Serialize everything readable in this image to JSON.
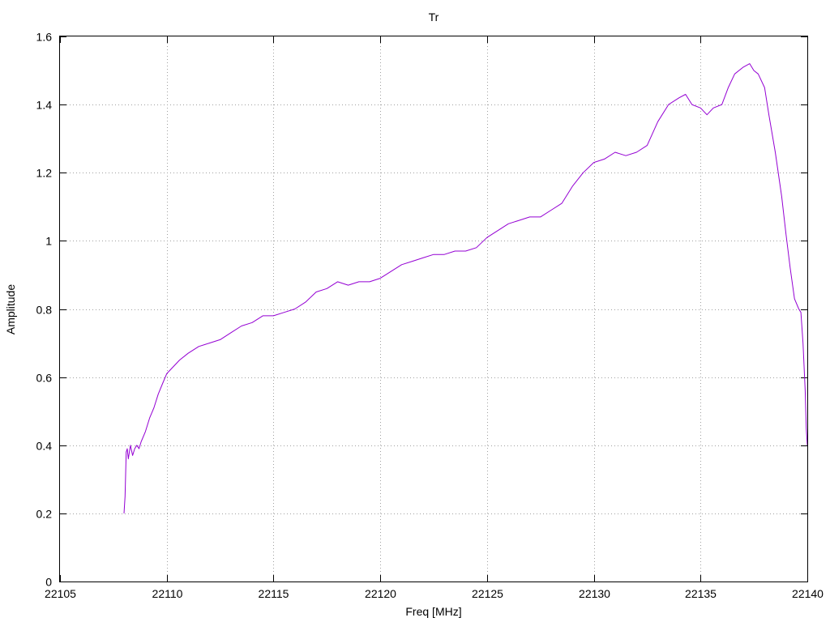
{
  "chart_data": {
    "type": "line",
    "title": "Tr",
    "xlabel": "Freq [MHz]",
    "ylabel": "Amplitude",
    "xlim": [
      22105,
      22140
    ],
    "ylim": [
      0,
      1.6
    ],
    "xticks": [
      22105,
      22110,
      22115,
      22120,
      22125,
      22130,
      22135,
      22140
    ],
    "yticks": [
      0,
      0.2,
      0.4,
      0.6,
      0.8,
      1,
      1.2,
      1.4,
      1.6
    ],
    "ytick_labels": [
      "0",
      "0.2",
      "0.4",
      "0.6",
      "0.8",
      "1",
      "1.2",
      "1.4",
      "1.6"
    ],
    "grid": true,
    "legend": "none",
    "series": [
      {
        "color": "#9400d3",
        "x": [
          22108.0,
          22108.05,
          22108.1,
          22108.15,
          22108.2,
          22108.25,
          22108.3,
          22108.4,
          22108.5,
          22108.6,
          22108.7,
          22108.8,
          22109.0,
          22109.2,
          22109.4,
          22109.6,
          22109.8,
          22110.0,
          22110.3,
          22110.6,
          22111.0,
          22111.5,
          22112.0,
          22112.5,
          22113.0,
          22113.5,
          22114.0,
          22114.5,
          22115.0,
          22115.5,
          22116.0,
          22116.5,
          22117.0,
          22117.5,
          22118.0,
          22118.5,
          22119.0,
          22119.5,
          22120.0,
          22120.5,
          22121.0,
          22121.5,
          22122.0,
          22122.5,
          22123.0,
          22123.5,
          22124.0,
          22124.5,
          22125.0,
          22125.5,
          22126.0,
          22126.5,
          22127.0,
          22127.5,
          22128.0,
          22128.5,
          22129.0,
          22129.5,
          22130.0,
          22130.5,
          22131.0,
          22131.5,
          22132.0,
          22132.5,
          22133.0,
          22133.5,
          22134.0,
          22134.3,
          22134.6,
          22135.0,
          22135.3,
          22135.6,
          22136.0,
          22136.3,
          22136.6,
          22137.0,
          22137.3,
          22137.5,
          22137.7,
          22138.0,
          22138.2,
          22138.5,
          22138.8,
          22139.0,
          22139.2,
          22139.4,
          22139.6,
          22139.7,
          22139.8,
          22139.9,
          22139.95,
          22140.0
        ],
        "y": [
          0.2,
          0.25,
          0.38,
          0.39,
          0.36,
          0.38,
          0.4,
          0.37,
          0.39,
          0.4,
          0.39,
          0.41,
          0.44,
          0.48,
          0.51,
          0.55,
          0.58,
          0.61,
          0.63,
          0.65,
          0.67,
          0.69,
          0.7,
          0.71,
          0.73,
          0.75,
          0.76,
          0.78,
          0.78,
          0.79,
          0.8,
          0.82,
          0.85,
          0.86,
          0.88,
          0.87,
          0.88,
          0.88,
          0.89,
          0.91,
          0.93,
          0.94,
          0.95,
          0.96,
          0.96,
          0.97,
          0.97,
          0.98,
          1.01,
          1.03,
          1.05,
          1.06,
          1.07,
          1.07,
          1.09,
          1.11,
          1.16,
          1.2,
          1.23,
          1.24,
          1.26,
          1.25,
          1.26,
          1.28,
          1.35,
          1.4,
          1.42,
          1.43,
          1.4,
          1.39,
          1.37,
          1.39,
          1.4,
          1.45,
          1.49,
          1.51,
          1.52,
          1.5,
          1.49,
          1.45,
          1.37,
          1.26,
          1.13,
          1.02,
          0.92,
          0.83,
          0.8,
          0.79,
          0.7,
          0.56,
          0.45,
          0.4
        ]
      }
    ]
  }
}
